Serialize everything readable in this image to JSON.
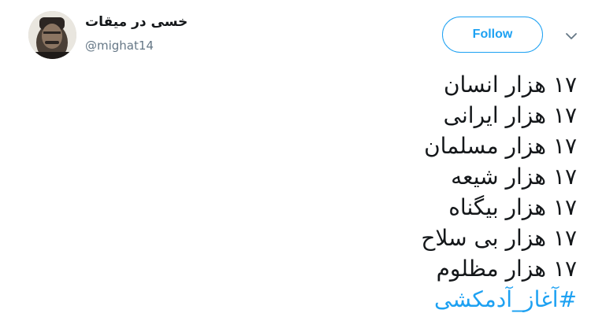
{
  "tweet": {
    "author_name": "خسی در میقات",
    "author_handle": "@mighat14",
    "follow_label": "Follow",
    "lines": [
      "۱۷ هزار انسان",
      "۱۷ هزار ایرانی",
      "۱۷ هزار مسلمان",
      "۱۷ هزار شیعه",
      "۱۷ هزار بیگناه",
      "۱۷ هزار بی سلاح",
      "۱۷ هزار مظلوم"
    ],
    "hashtag": "#آغاز_آدمکشی"
  },
  "icons": {
    "menu": "chevron-down-icon"
  },
  "colors": {
    "accent": "#1da1f2",
    "text": "#14171a",
    "secondary": "#657786"
  }
}
